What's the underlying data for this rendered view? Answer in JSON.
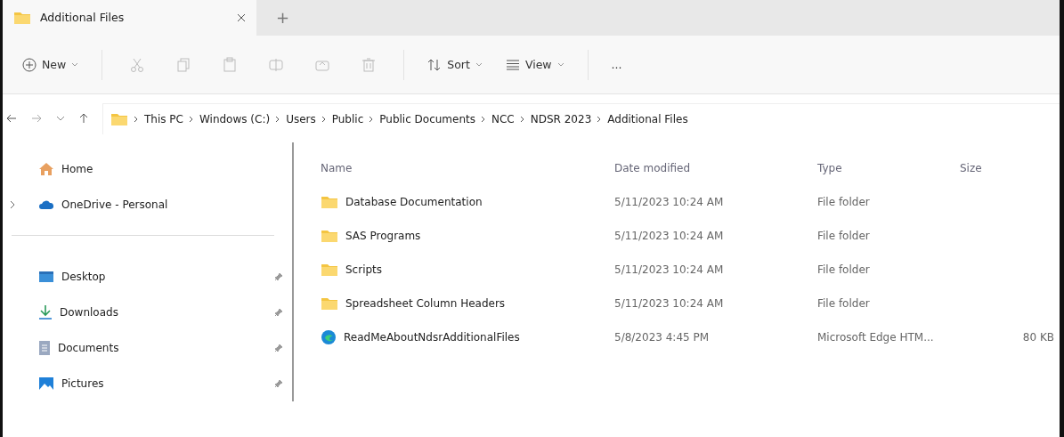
{
  "tab": {
    "title": "Additional Files",
    "selected": true
  },
  "new_tab": "+",
  "toolbar": {
    "new": "New",
    "actions": [
      {
        "kind": "cut",
        "disabled": true
      },
      {
        "kind": "copy",
        "disabled": true
      },
      {
        "kind": "paste",
        "disabled": true
      },
      {
        "kind": "rename",
        "disabled": true
      },
      {
        "kind": "share",
        "disabled": true
      },
      {
        "kind": "delete",
        "disabled": true
      }
    ],
    "sort": "Sort",
    "view": "View",
    "more": "..."
  },
  "breadcrumb": [
    "This PC",
    "Windows (C:)",
    "Users",
    "Public",
    "Public Documents",
    "NCC",
    "NDSR 2023",
    "Additional Files"
  ],
  "sidebar": {
    "top": [
      {
        "kind": "home",
        "label": "Home",
        "expandable": false
      },
      {
        "kind": "cloud",
        "label": "OneDrive - Personal",
        "expandable": true
      }
    ],
    "pinned": [
      {
        "kind": "desktop",
        "label": "Desktop",
        "pinned": true
      },
      {
        "kind": "downloads",
        "label": "Downloads",
        "pinned": true
      },
      {
        "kind": "documents",
        "label": "Documents",
        "pinned": true
      },
      {
        "kind": "pictures",
        "label": "Pictures",
        "pinned": true
      }
    ]
  },
  "table": {
    "columns": [
      "Name",
      "Date modified",
      "Type",
      "Size"
    ],
    "rows": [
      {
        "kind": "folder",
        "name": "Database Documentation",
        "date": "5/11/2023 10:24 AM",
        "type": "File folder",
        "size": ""
      },
      {
        "kind": "folder",
        "name": "SAS Programs",
        "date": "5/11/2023 10:24 AM",
        "type": "File folder",
        "size": ""
      },
      {
        "kind": "folder",
        "name": "Scripts",
        "date": "5/11/2023 10:24 AM",
        "type": "File folder",
        "size": ""
      },
      {
        "kind": "folder",
        "name": "Spreadsheet Column Headers",
        "date": "5/11/2023 10:24 AM",
        "type": "File folder",
        "size": ""
      },
      {
        "kind": "edge",
        "name": "ReadMeAboutNdsrAdditionalFiles",
        "date": "5/8/2023 4:45 PM",
        "type": "Microsoft Edge HTM...",
        "size": "80 KB"
      }
    ]
  }
}
